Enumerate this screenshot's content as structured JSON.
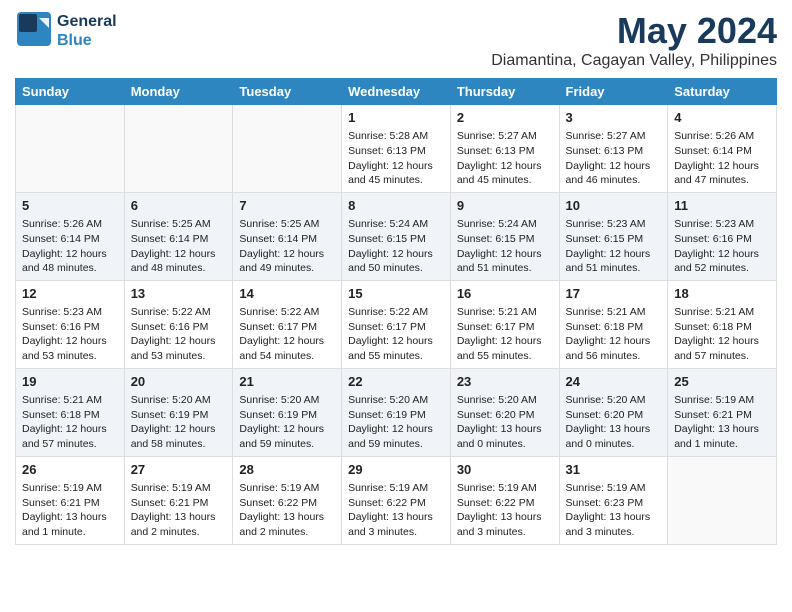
{
  "logo": {
    "line1": "General",
    "line2": "Blue"
  },
  "title": "May 2024",
  "subtitle": "Diamantina, Cagayan Valley, Philippines",
  "days_of_week": [
    "Sunday",
    "Monday",
    "Tuesday",
    "Wednesday",
    "Thursday",
    "Friday",
    "Saturday"
  ],
  "weeks": [
    [
      {
        "num": "",
        "info": ""
      },
      {
        "num": "",
        "info": ""
      },
      {
        "num": "",
        "info": ""
      },
      {
        "num": "1",
        "info": "Sunrise: 5:28 AM\nSunset: 6:13 PM\nDaylight: 12 hours and 45 minutes."
      },
      {
        "num": "2",
        "info": "Sunrise: 5:27 AM\nSunset: 6:13 PM\nDaylight: 12 hours and 45 minutes."
      },
      {
        "num": "3",
        "info": "Sunrise: 5:27 AM\nSunset: 6:13 PM\nDaylight: 12 hours and 46 minutes."
      },
      {
        "num": "4",
        "info": "Sunrise: 5:26 AM\nSunset: 6:14 PM\nDaylight: 12 hours and 47 minutes."
      }
    ],
    [
      {
        "num": "5",
        "info": "Sunrise: 5:26 AM\nSunset: 6:14 PM\nDaylight: 12 hours and 48 minutes."
      },
      {
        "num": "6",
        "info": "Sunrise: 5:25 AM\nSunset: 6:14 PM\nDaylight: 12 hours and 48 minutes."
      },
      {
        "num": "7",
        "info": "Sunrise: 5:25 AM\nSunset: 6:14 PM\nDaylight: 12 hours and 49 minutes."
      },
      {
        "num": "8",
        "info": "Sunrise: 5:24 AM\nSunset: 6:15 PM\nDaylight: 12 hours and 50 minutes."
      },
      {
        "num": "9",
        "info": "Sunrise: 5:24 AM\nSunset: 6:15 PM\nDaylight: 12 hours and 51 minutes."
      },
      {
        "num": "10",
        "info": "Sunrise: 5:23 AM\nSunset: 6:15 PM\nDaylight: 12 hours and 51 minutes."
      },
      {
        "num": "11",
        "info": "Sunrise: 5:23 AM\nSunset: 6:16 PM\nDaylight: 12 hours and 52 minutes."
      }
    ],
    [
      {
        "num": "12",
        "info": "Sunrise: 5:23 AM\nSunset: 6:16 PM\nDaylight: 12 hours and 53 minutes."
      },
      {
        "num": "13",
        "info": "Sunrise: 5:22 AM\nSunset: 6:16 PM\nDaylight: 12 hours and 53 minutes."
      },
      {
        "num": "14",
        "info": "Sunrise: 5:22 AM\nSunset: 6:17 PM\nDaylight: 12 hours and 54 minutes."
      },
      {
        "num": "15",
        "info": "Sunrise: 5:22 AM\nSunset: 6:17 PM\nDaylight: 12 hours and 55 minutes."
      },
      {
        "num": "16",
        "info": "Sunrise: 5:21 AM\nSunset: 6:17 PM\nDaylight: 12 hours and 55 minutes."
      },
      {
        "num": "17",
        "info": "Sunrise: 5:21 AM\nSunset: 6:18 PM\nDaylight: 12 hours and 56 minutes."
      },
      {
        "num": "18",
        "info": "Sunrise: 5:21 AM\nSunset: 6:18 PM\nDaylight: 12 hours and 57 minutes."
      }
    ],
    [
      {
        "num": "19",
        "info": "Sunrise: 5:21 AM\nSunset: 6:18 PM\nDaylight: 12 hours and 57 minutes."
      },
      {
        "num": "20",
        "info": "Sunrise: 5:20 AM\nSunset: 6:19 PM\nDaylight: 12 hours and 58 minutes."
      },
      {
        "num": "21",
        "info": "Sunrise: 5:20 AM\nSunset: 6:19 PM\nDaylight: 12 hours and 59 minutes."
      },
      {
        "num": "22",
        "info": "Sunrise: 5:20 AM\nSunset: 6:19 PM\nDaylight: 12 hours and 59 minutes."
      },
      {
        "num": "23",
        "info": "Sunrise: 5:20 AM\nSunset: 6:20 PM\nDaylight: 13 hours and 0 minutes."
      },
      {
        "num": "24",
        "info": "Sunrise: 5:20 AM\nSunset: 6:20 PM\nDaylight: 13 hours and 0 minutes."
      },
      {
        "num": "25",
        "info": "Sunrise: 5:19 AM\nSunset: 6:21 PM\nDaylight: 13 hours and 1 minute."
      }
    ],
    [
      {
        "num": "26",
        "info": "Sunrise: 5:19 AM\nSunset: 6:21 PM\nDaylight: 13 hours and 1 minute."
      },
      {
        "num": "27",
        "info": "Sunrise: 5:19 AM\nSunset: 6:21 PM\nDaylight: 13 hours and 2 minutes."
      },
      {
        "num": "28",
        "info": "Sunrise: 5:19 AM\nSunset: 6:22 PM\nDaylight: 13 hours and 2 minutes."
      },
      {
        "num": "29",
        "info": "Sunrise: 5:19 AM\nSunset: 6:22 PM\nDaylight: 13 hours and 3 minutes."
      },
      {
        "num": "30",
        "info": "Sunrise: 5:19 AM\nSunset: 6:22 PM\nDaylight: 13 hours and 3 minutes."
      },
      {
        "num": "31",
        "info": "Sunrise: 5:19 AM\nSunset: 6:23 PM\nDaylight: 13 hours and 3 minutes."
      },
      {
        "num": "",
        "info": ""
      }
    ]
  ]
}
